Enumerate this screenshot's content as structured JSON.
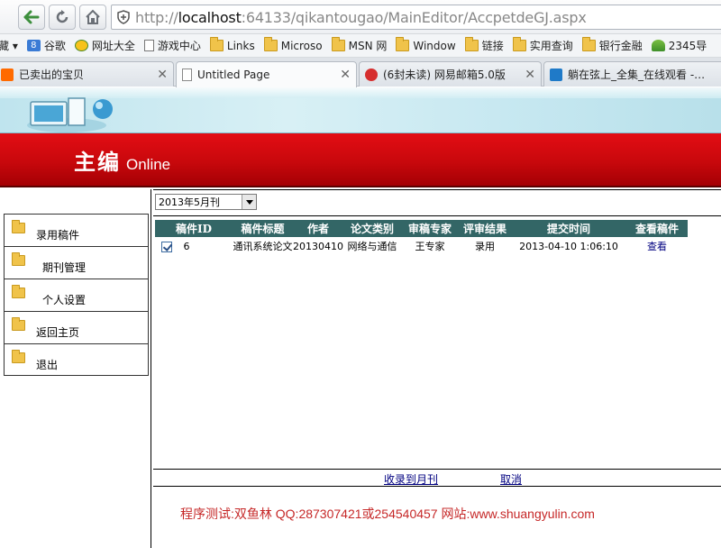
{
  "browser": {
    "url_prefix": "http://",
    "url_host": "localhost",
    "url_rest": ":64133/qikantougao/MainEditor/AccpetdeGJ.aspx",
    "bookmarks": [
      {
        "label": "藏 ▾",
        "icon": "bookmark-star-icon"
      },
      {
        "label": "谷歌",
        "icon": "google-icon"
      },
      {
        "label": "网址大全",
        "icon": "site-directory-icon"
      },
      {
        "label": "游戏中心",
        "icon": "page-icon"
      },
      {
        "label": "Links",
        "icon": "folder-icon"
      },
      {
        "label": "Microso",
        "icon": "folder-icon"
      },
      {
        "label": "MSN 网",
        "icon": "folder-icon"
      },
      {
        "label": "Window",
        "icon": "folder-icon"
      },
      {
        "label": "链接",
        "icon": "folder-icon"
      },
      {
        "label": "实用查询",
        "icon": "folder-icon"
      },
      {
        "label": "银行金融",
        "icon": "folder-icon"
      },
      {
        "label": "2345导",
        "icon": "2345-icon"
      }
    ],
    "tabs": [
      {
        "label": "已卖出的宝贝",
        "active": false
      },
      {
        "label": "Untitled Page",
        "active": true
      },
      {
        "label": "(6封未读) 网易邮箱5.0版",
        "active": false
      },
      {
        "label": "躺在弦上_全集_在线观看 -…",
        "active": false
      }
    ]
  },
  "header": {
    "title_cn": "主编",
    "title_en": "Online"
  },
  "sidebar": {
    "items": [
      {
        "label": "录用稿件"
      },
      {
        "label": "期刊管理"
      },
      {
        "label": "个人设置"
      },
      {
        "label": "返回主页"
      },
      {
        "label": "退出"
      }
    ]
  },
  "main": {
    "issue_select": "2013年5月刊",
    "table": {
      "columns": [
        "稿件ID",
        "稿件标题",
        "作者",
        "论文类别",
        "审稿专家",
        "评审结果",
        "提交时间",
        "查看稿件"
      ],
      "rows": [
        {
          "checked": true,
          "id": "6",
          "title": "通讯系统论文",
          "author": "20130410",
          "category": "网络与通信",
          "expert": "王专家",
          "result": "录用",
          "submitted": "2013-04-10 1:06:10",
          "view": "查看"
        }
      ]
    },
    "actions": {
      "add_to_issue": "收录到月刊",
      "cancel": "取消"
    },
    "footer_note": "程序测试:双鱼林 QQ:287307421或254540457 网站:www.shuangyulin.com"
  },
  "colors": {
    "header_red": "#c8080c",
    "table_header": "#336666",
    "link": "#000080",
    "footer_text": "#c62828"
  }
}
